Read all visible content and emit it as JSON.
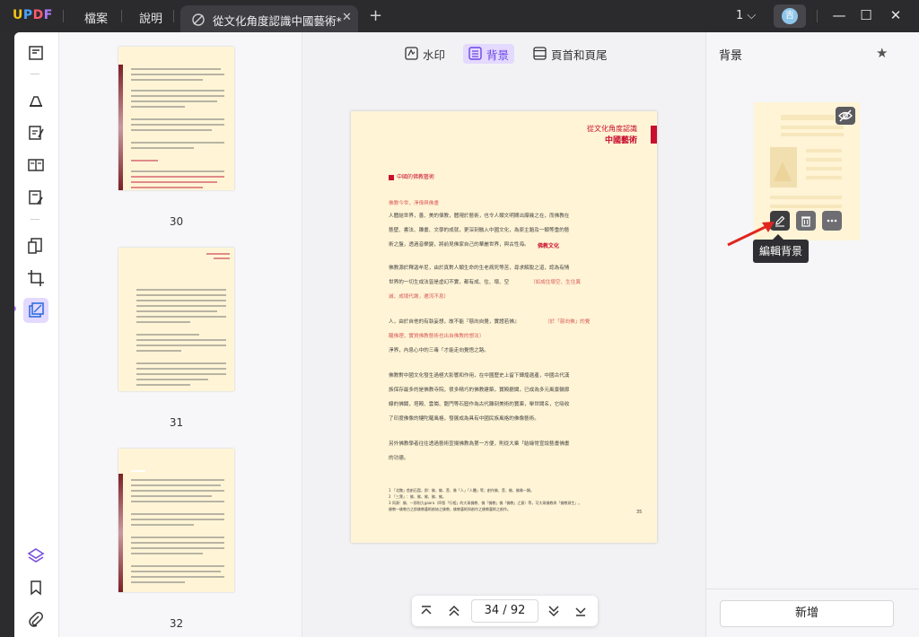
{
  "app": {
    "logo": "UPDF",
    "menu": [
      "檔案",
      "說明"
    ]
  },
  "tab": {
    "title": "從文化角度認識中國藝術*",
    "close": "✕",
    "new": "+"
  },
  "window": {
    "page_indicator": "1",
    "avatar_letter": "吉",
    "minimize": "—",
    "maximize": "☐",
    "close": "✕"
  },
  "toolbar": {
    "watermark": "水印",
    "background": "背景",
    "header_footer": "頁首和頁尾"
  },
  "thumbnails": [
    {
      "page": "30"
    },
    {
      "page": "31"
    },
    {
      "page": "32"
    }
  ],
  "document_page": {
    "header_small": "從文化角度認識",
    "header_large": "中國藝術",
    "section_heading": "中國的佛教藝術",
    "subheading": "佛教今世，淨偉與佛畫",
    "lines": [
      "人體結世界，善、美的偉教，體現於藝術，也令人類文明間出爆幾之在，而佛教在",
      "藝壁、書法、雕畫、文學的成就，更深刻融入中國文化，為原主題及一類等重的藝",
      "術之盤，透過音樂變，將前見佛家自己的華麗世界，與古性海。",
      "佛教源於釋迦牟尼，由於真對人類生命的生老病死等苦，尋求解脫之道，認為有情",
      "世界的一切生成法皆是虛幻不實，都有成、住、壞、空",
      "人，由於自他的有執妄想，故不能『慈向自覺，實證若佛』",
      "淨界，內息心中的三毒「才能走向覺悟之路。",
      "佛教對中國文化發生過極大影響和作用，在中國歷史上留下輝煌遺產，中國古代漢",
      "族保存最多的是佛教寺院，很多精巧的佛教建築，寶殿廳閣，已成為多元風景輪廓",
      "線的佛閣，塔殿、雲崗、龍門等石窟作為古代雕刻美術的寶庫，舉世聞名，它吸收",
      "了印度佛像的犍陀羅風格，發展成為具有中國民族風格的佛像藝術。",
      "另外佛教學者往往透過藝術宣揚佛教為第一方便，則從大乘「結緣常宣說藝畫佛畫",
      "的功德。"
    ],
    "red_inline": [
      "佛教文化",
      "（如成住壞空、生住異",
      "滅、成壞代謝，遷流不息）",
      "〔於「慈向佛」的覺",
      "醒佛理，實質佛教藝術也出自佛教的想法〕"
    ],
    "footnotes": [
      "1 「北魏」首創石窟，即：佛、佛、菩、像「人」「人體」等；創作佛、菩、佛、佛像一類。",
      "2 「三寶」：佛、佛、佛、佛、佛。",
      "3 同源：佛、一即則九gaara（四智「行相」的大乘佛教、佛「佛教」佛「佛教」之意）等，可大乘佛教與「佛教源生」。",
      "   佛教一佛教古之即佛教藝術創始之佛教，佛教藝術與創作之佛教藝術之創作。"
    ],
    "page_number": "35"
  },
  "navigation": {
    "current_page": "34",
    "separator": "/",
    "total_pages": "92"
  },
  "right_panel": {
    "title": "背景",
    "tooltip": "編輯背景",
    "add_button": "新增"
  },
  "colors": {
    "accent": "#6b46e5",
    "page_bg": "#fff4d5",
    "heading_red": "#c8102e",
    "arrow_red": "#e0261f"
  },
  "icons": [
    "reader-icon",
    "highlighter-icon",
    "edit-text-icon",
    "organize-pages-icon",
    "fill-sign-icon",
    "convert-icon",
    "crop-icon",
    "page-tools-icon",
    "layers-icon",
    "bookmark-icon",
    "attachment-icon",
    "star-icon",
    "edit-icon",
    "trash-icon",
    "more-icon",
    "eye-off-icon"
  ]
}
